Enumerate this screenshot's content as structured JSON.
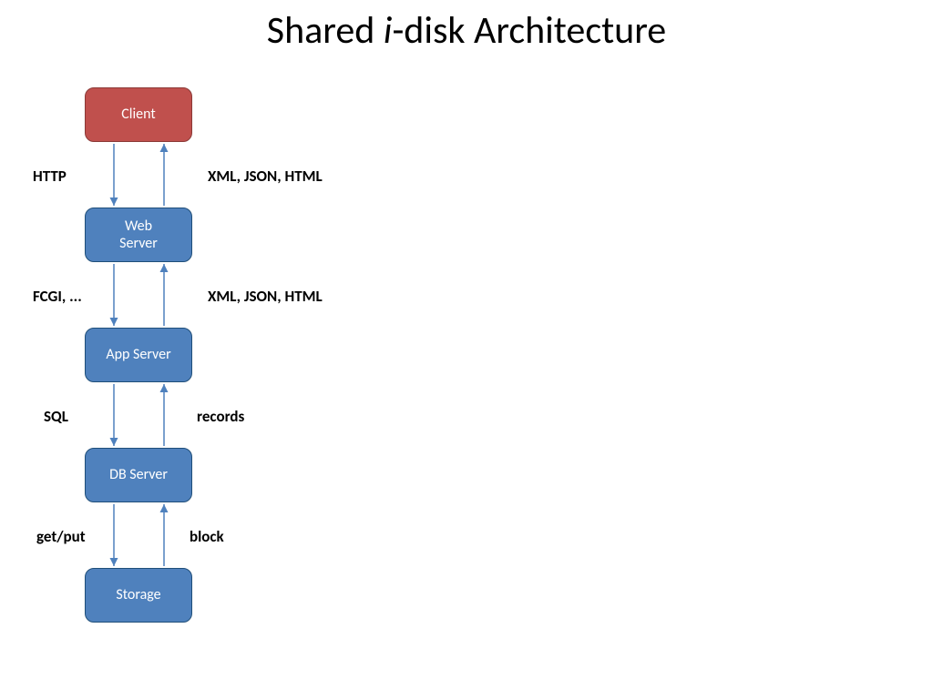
{
  "title": {
    "prefix": "Shared ",
    "italic": "i",
    "suffix": "-disk Architecture"
  },
  "boxes": {
    "client": "Client",
    "webserver": "Web\nServer",
    "appserver": "App Server",
    "dbserver": "DB Server",
    "storage": "Storage"
  },
  "labels": {
    "l1_left": "HTTP",
    "l1_right": "XML, JSON, HTML",
    "l2_left": "FCGI, ...",
    "l2_right": "XML, JSON, HTML",
    "l3_left": "SQL",
    "l3_right": "records",
    "l4_left": "get/put",
    "l4_right": "block"
  },
  "colors": {
    "client_fill": "#c0504d",
    "box_fill": "#4f81bd",
    "box_border": "#1f4e79",
    "arrow": "#4f81bd"
  }
}
